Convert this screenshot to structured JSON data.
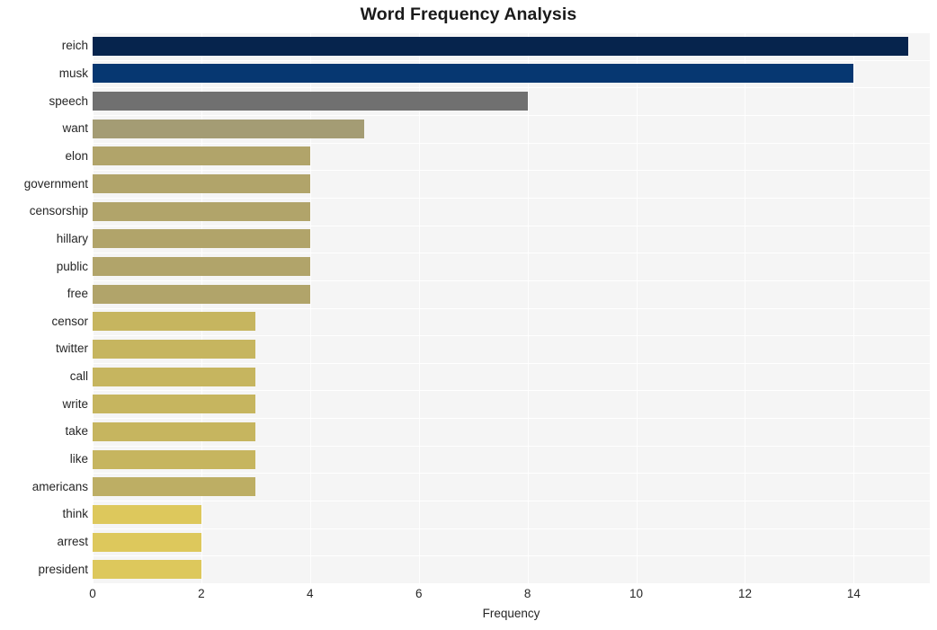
{
  "chart_data": {
    "type": "bar",
    "orientation": "horizontal",
    "title": "Word Frequency Analysis",
    "xlabel": "Frequency",
    "ylabel": "",
    "xlim": [
      0,
      15.4
    ],
    "ylim": [
      0,
      20
    ],
    "grid": true,
    "legend": null,
    "xticks": [
      0,
      2,
      4,
      6,
      8,
      10,
      12,
      14
    ],
    "xtick_labels": [
      "0",
      "2",
      "4",
      "6",
      "8",
      "10",
      "12",
      "14"
    ],
    "categories": [
      "reich",
      "musk",
      "speech",
      "want",
      "elon",
      "government",
      "censorship",
      "hillary",
      "public",
      "free",
      "censor",
      "twitter",
      "call",
      "write",
      "take",
      "like",
      "americans",
      "think",
      "arrest",
      "president"
    ],
    "values": [
      15,
      14,
      8,
      5,
      4,
      4,
      4,
      4,
      4,
      4,
      3,
      3,
      3,
      3,
      3,
      3,
      3,
      2,
      2,
      2
    ],
    "bar_colors": [
      "#06244d",
      "#063771",
      "#707070",
      "#a49c74",
      "#b1a46a",
      "#b1a46a",
      "#b1a46a",
      "#b1a46a",
      "#b1a46a",
      "#b1a46a",
      "#c6b55f",
      "#c6b55f",
      "#c6b55f",
      "#c6b55f",
      "#c6b55f",
      "#c6b55f",
      "#bdae64",
      "#ddc85c",
      "#ddc85c",
      "#ddc85c"
    ],
    "plot_background": "#f5f5f5",
    "gridline_color": "#ffffff",
    "figure_background": "#ffffff",
    "text_color": "#262626"
  }
}
